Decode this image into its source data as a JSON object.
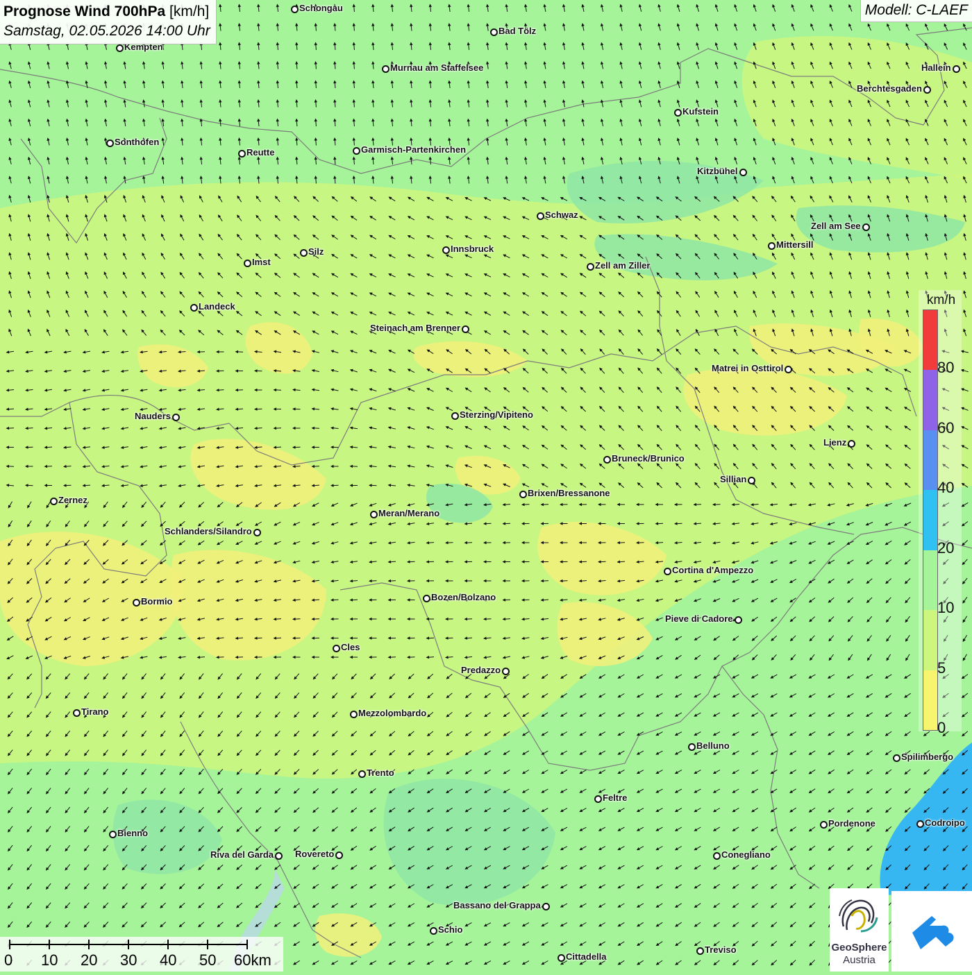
{
  "header": {
    "title_bold": "Prognose Wind 700hPa",
    "title_unit": "[km/h]",
    "subtitle": "Samstag, 02.05.2026 14:00 Uhr",
    "model": "Modell: C-LAEF"
  },
  "colors": {
    "map_background_green": "#a6f49a",
    "zone_yellow_green": "#cdf67e",
    "zone_yellow": "#f2f07a",
    "zone_teal": "#8fe6a6",
    "sea_blue": "#36b7f2",
    "border_gray": "#7c7c7c"
  },
  "legend": {
    "unit": "km/h",
    "ticks": [
      "80",
      "60",
      "40",
      "20",
      "10",
      "5",
      "0"
    ],
    "colors": [
      "#f23b3b",
      "#8f63e8",
      "#5a8ff2",
      "#2fc1f2",
      "#a6f49a",
      "#cdf67e",
      "#f7f56e"
    ]
  },
  "scale_bar": {
    "labels": [
      "0",
      "10",
      "20",
      "30",
      "40",
      "50",
      "60km"
    ]
  },
  "logos": {
    "geosphere_line1": "GeoSphere",
    "geosphere_line2": "Austria",
    "app_icon": "wind-arrow-cloud-icon"
  },
  "cities": [
    {
      "name": "Schongau"
    },
    {
      "name": "Bad Tölz"
    },
    {
      "name": "Kempten"
    },
    {
      "name": "Murnau am Staffelsee"
    },
    {
      "name": "Hallein"
    },
    {
      "name": "Berchtesgaden"
    },
    {
      "name": "Kufstein"
    },
    {
      "name": "Sonthofen"
    },
    {
      "name": "Reutte"
    },
    {
      "name": "Garmisch-Partenkirchen"
    },
    {
      "name": "Kitzbühel"
    },
    {
      "name": "Schwaz"
    },
    {
      "name": "Zell am See"
    },
    {
      "name": "Mittersill"
    },
    {
      "name": "Silz"
    },
    {
      "name": "Innsbruck"
    },
    {
      "name": "Imst"
    },
    {
      "name": "Zell am Ziller"
    },
    {
      "name": "Landeck"
    },
    {
      "name": "Steinach am Brenner"
    },
    {
      "name": "Matrei in Osttirol"
    },
    {
      "name": "Nauders"
    },
    {
      "name": "Sterzing/Vipiteno"
    },
    {
      "name": "Lienz"
    },
    {
      "name": "Bruneck/Brunico"
    },
    {
      "name": "Sillian"
    },
    {
      "name": "Zernez"
    },
    {
      "name": "Brixen/Bressanone"
    },
    {
      "name": "Meran/Merano"
    },
    {
      "name": "Schlanders/Silandro"
    },
    {
      "name": "Cortina d'Ampezzo"
    },
    {
      "name": "Bozen/Bolzano"
    },
    {
      "name": "Bormio"
    },
    {
      "name": "Pieve di Cadore"
    },
    {
      "name": "Cles"
    },
    {
      "name": "Predazzo"
    },
    {
      "name": "Tirano"
    },
    {
      "name": "Mezzolombardo"
    },
    {
      "name": "Belluno"
    },
    {
      "name": "Spilimbergo"
    },
    {
      "name": "Trento"
    },
    {
      "name": "Feltre"
    },
    {
      "name": "Pordenone"
    },
    {
      "name": "Codroipo"
    },
    {
      "name": "Bienno"
    },
    {
      "name": "Riva del Garda"
    },
    {
      "name": "Rovereto"
    },
    {
      "name": "Conegliano"
    },
    {
      "name": "Bassano del Grappa"
    },
    {
      "name": "Schio"
    },
    {
      "name": "Treviso"
    },
    {
      "name": "Cittadella"
    }
  ]
}
